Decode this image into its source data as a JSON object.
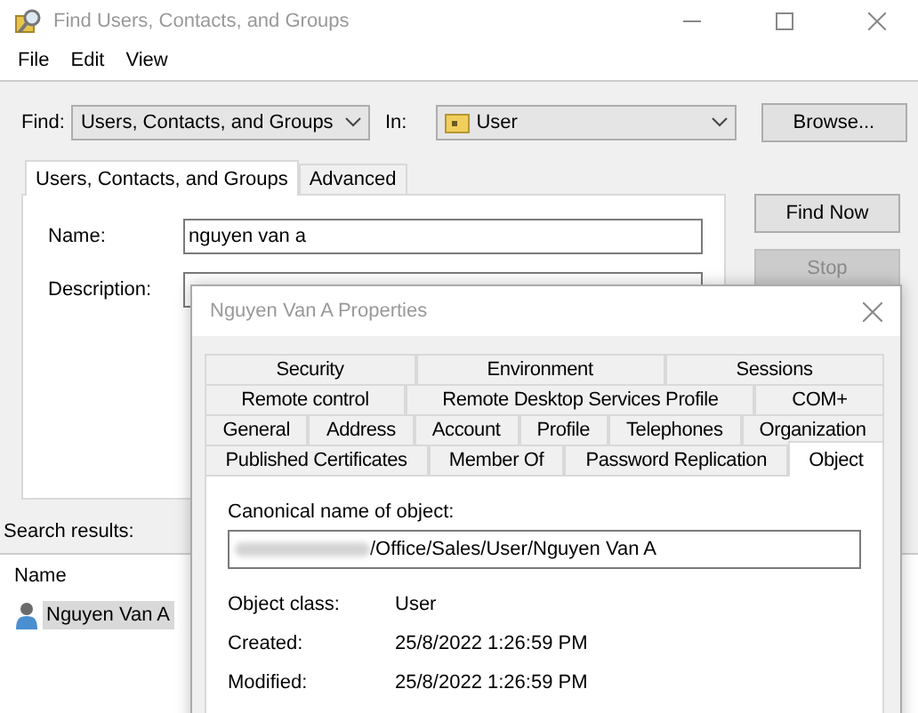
{
  "window": {
    "title": "Find Users, Contacts, and Groups"
  },
  "menu": [
    "File",
    "Edit",
    "View"
  ],
  "find": {
    "label": "Find:",
    "value": "Users, Contacts, and Groups"
  },
  "in": {
    "label": "In:",
    "value": "User"
  },
  "browse_button": "Browse...",
  "tabs": [
    {
      "label": "Users, Contacts, and Groups",
      "selected": true
    },
    {
      "label": "Advanced",
      "selected": false
    }
  ],
  "fields": [
    {
      "label": "Name:",
      "value": "nguyen van a"
    },
    {
      "label": "Description:"
    }
  ],
  "buttons": [
    {
      "label": "Find Now",
      "disabled": false
    },
    {
      "label": "Stop",
      "disabled": true
    }
  ],
  "search_results": {
    "label": "Search results:",
    "columns": [
      "Name"
    ],
    "rows": [
      {
        "name": "Nguyen Van A",
        "selected": true
      }
    ]
  },
  "properties": {
    "title": "Nguyen Van A Properties",
    "tab_rows": [
      [
        {
          "label": "Security",
          "selected": false
        },
        {
          "label": "Environment",
          "selected": false
        },
        {
          "label": "Sessions",
          "selected": false
        }
      ],
      [
        {
          "label": "Remote control",
          "selected": false
        },
        {
          "label": "Remote Desktop Services Profile",
          "selected": false
        },
        {
          "label": "COM+",
          "selected": false
        }
      ],
      [
        {
          "label": "General",
          "selected": false
        },
        {
          "label": "Address",
          "selected": false
        },
        {
          "label": "Account",
          "selected": false
        },
        {
          "label": "Profile",
          "selected": false
        },
        {
          "label": "Telephones",
          "selected": false
        },
        {
          "label": "Organization",
          "selected": false
        }
      ],
      [
        {
          "label": "Published Certificates",
          "selected": false
        },
        {
          "label": "Member Of",
          "selected": false
        },
        {
          "label": "Password Replication",
          "selected": false
        },
        {
          "label": "Object",
          "selected": true
        }
      ]
    ],
    "canonical_label": "Canonical name of object:",
    "canonical_value": "/Office/Sales/User/Nguyen Van A",
    "details": [
      {
        "label": "Object class:",
        "value": "User"
      },
      {
        "label": "Created:",
        "value": "25/8/2022 1:26:59 PM"
      },
      {
        "label": "Modified:",
        "value": "25/8/2022 1:26:59 PM"
      }
    ]
  }
}
